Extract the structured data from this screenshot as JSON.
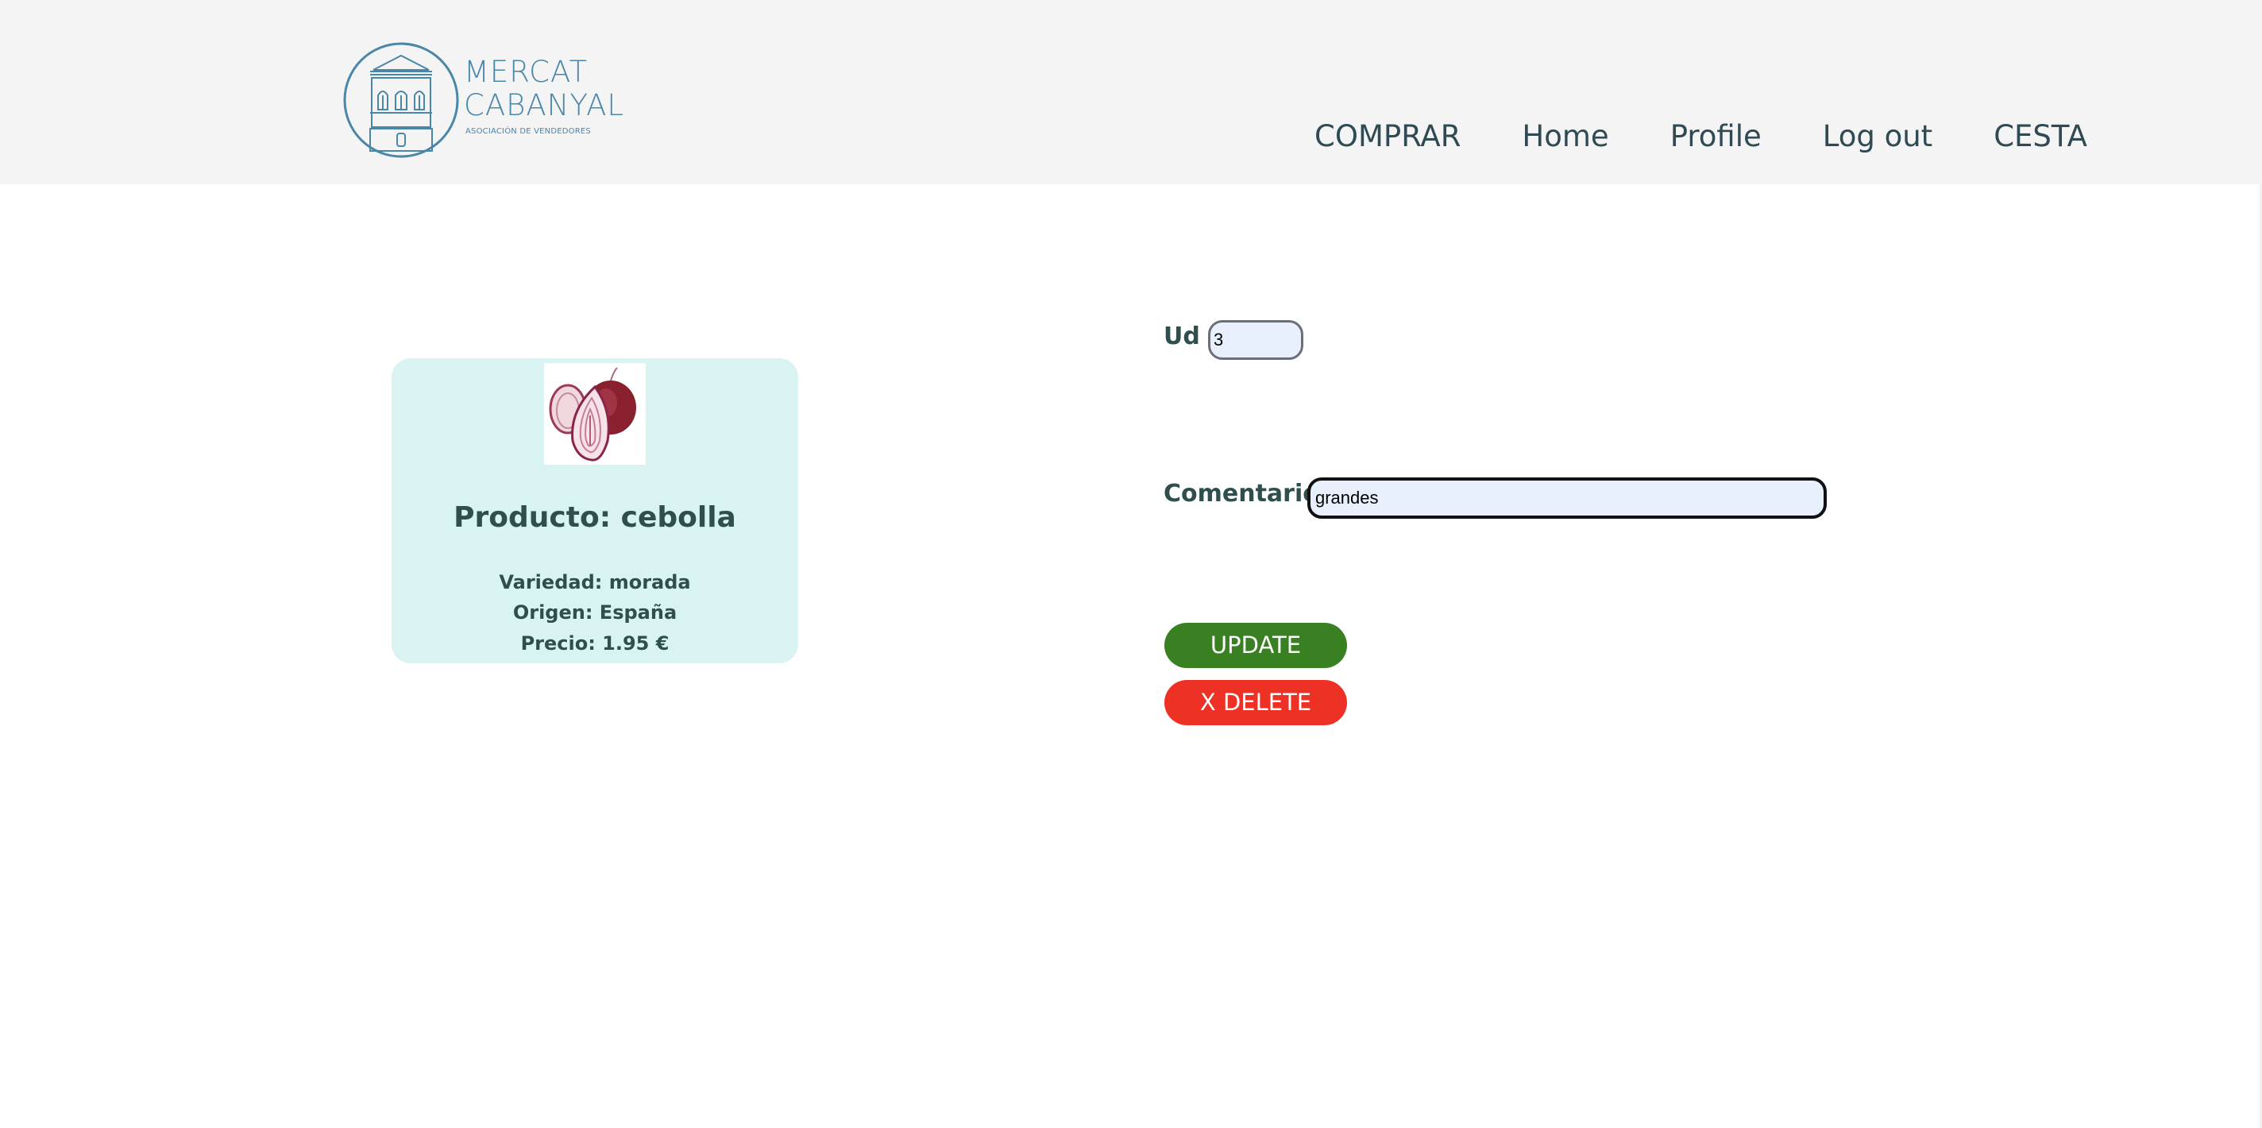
{
  "header": {
    "logo": {
      "line1": "MERCAT",
      "line2": "CABANYAL",
      "subtitle": "ASOCIACIÓN DE VENDEDORES",
      "icon": "market-building-icon",
      "color": "#4a86a8"
    },
    "nav": [
      "COMPRAR",
      "Home",
      "Profile",
      "Log out",
      "CESTA"
    ]
  },
  "product": {
    "image": "onion-image",
    "title": "Producto: cebolla",
    "variedad": "Variedad: morada",
    "origen": "Origen: España",
    "precio": "Precio: 1.95 €",
    "card_color": "#d9f3f2"
  },
  "form": {
    "ud_label": "Ud :",
    "ud_value": "3",
    "comentario_label": "Comentario :",
    "comentario_value": "grandes",
    "update_label": "UPDATE",
    "delete_label": "X DELETE",
    "update_color": "#388022",
    "delete_color": "#ed3124"
  }
}
